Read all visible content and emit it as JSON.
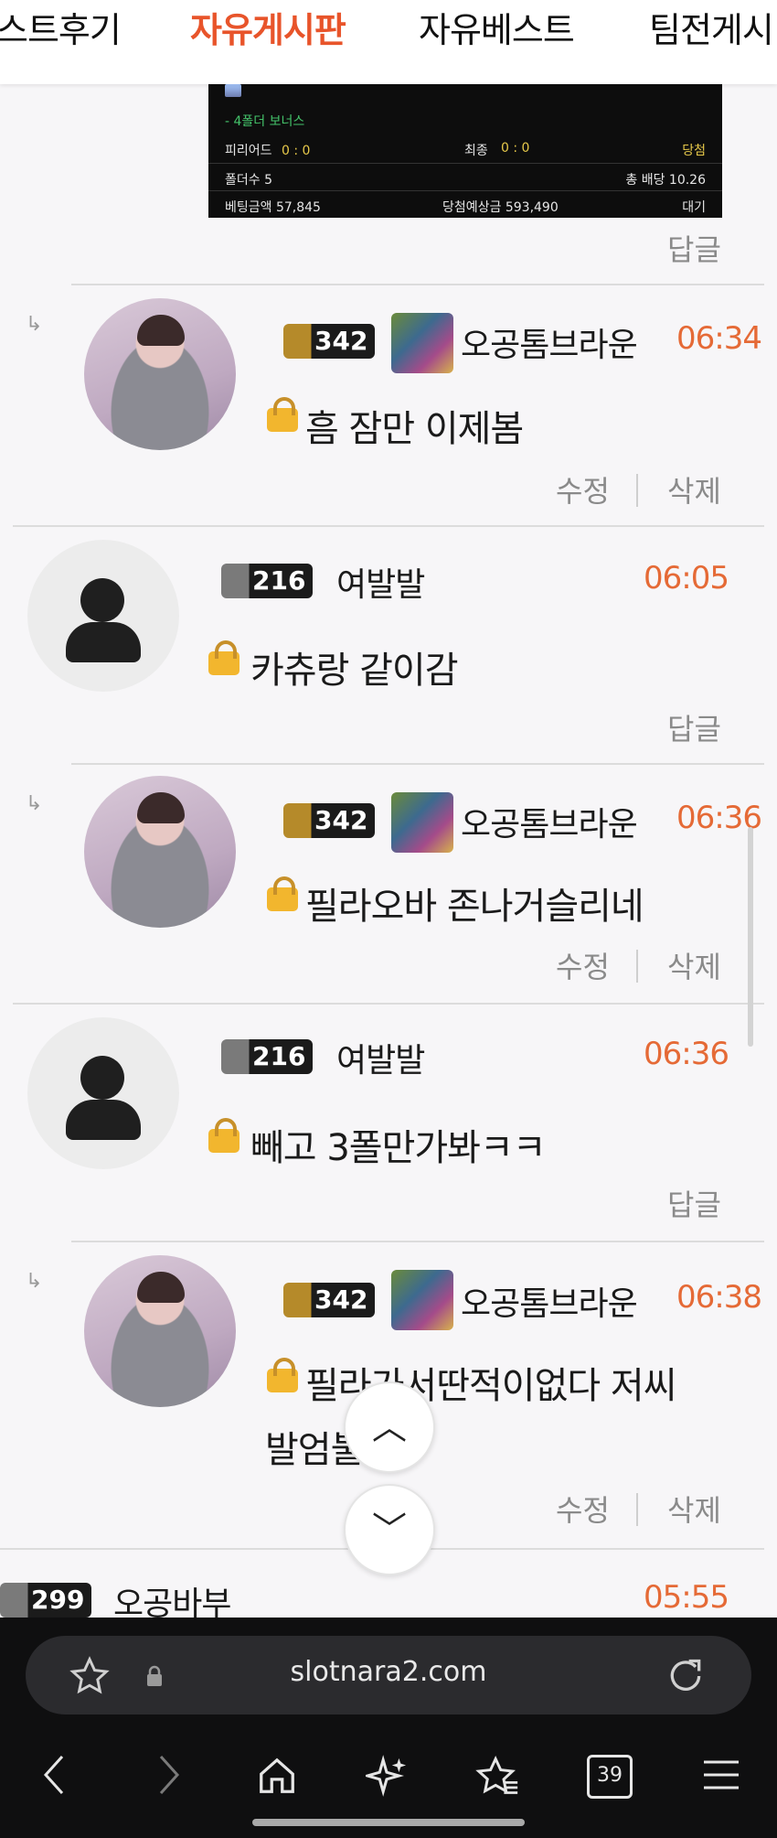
{
  "tabs": [
    "스트후기",
    "자유게시판",
    "자유베스트",
    "팀전게시"
  ],
  "slip": {
    "bonus": "- 4폴더 보너스",
    "period_label": "피리어드",
    "period_score": "0 : 0",
    "final_label": "최종",
    "final_score": "0 : 0",
    "status_win": "당첨",
    "folders_label": "폴더수 5",
    "total_odds_label": "총 배당 10.26",
    "bet_amount_label": "베팅금액 57,845",
    "expected_label": "당첨예상금 593,490",
    "status_wait": "대기"
  },
  "reply_label": "답글",
  "edit_label": "수정",
  "delete_label": "삭제",
  "comments": [
    {
      "level": "342",
      "nick": "오공톰브라운",
      "time": "06:34",
      "text": "흠 잠만 이제봄"
    },
    {
      "level": "216",
      "nick": "여발발",
      "time": "06:05",
      "text": "카츄랑 같이감"
    },
    {
      "level": "342",
      "nick": "오공톰브라운",
      "time": "06:36",
      "text": "필라오바 존나거슬리네"
    },
    {
      "level": "216",
      "nick": "여발발",
      "time": "06:36",
      "text": "빼고 3폴만가봐ㅋㅋ"
    },
    {
      "level": "342",
      "nick": "오공톰브라운",
      "time": "06:38",
      "text_line1": "필라가서딴적이없다 저씨",
      "text_line2": "발엄불"
    },
    {
      "level": "299",
      "nick": "오공바부",
      "time": "05:55"
    }
  ],
  "browser": {
    "url": "slotnara2.com",
    "tab_count": "39"
  }
}
